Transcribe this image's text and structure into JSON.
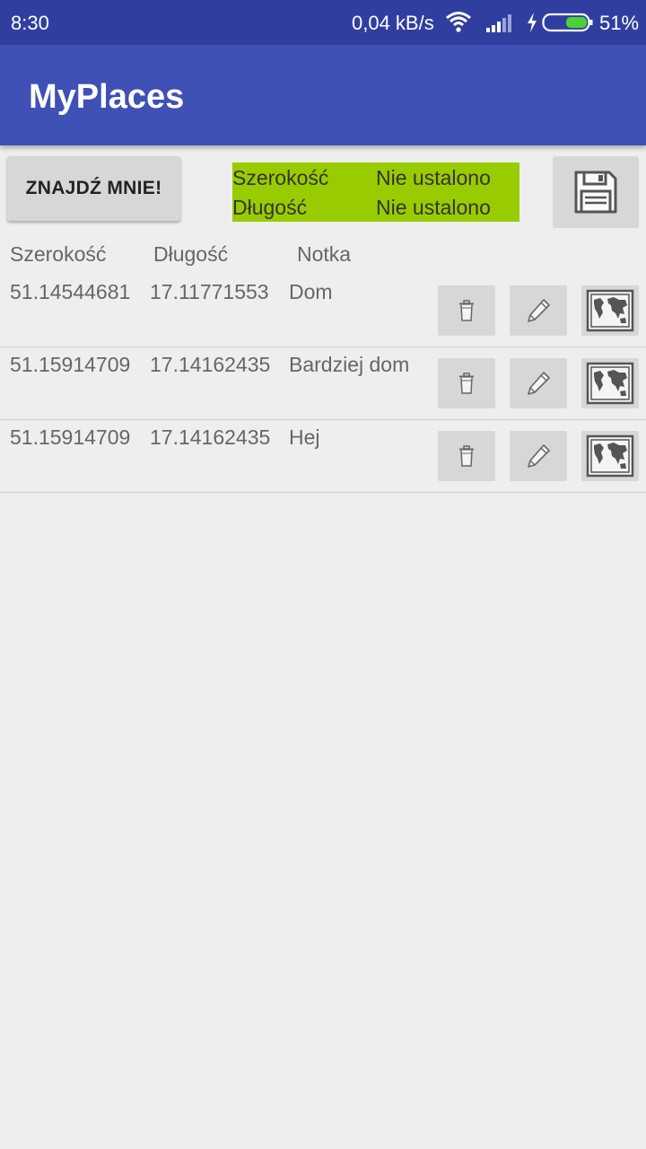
{
  "status_bar": {
    "time": "8:30",
    "network_speed": "0,04 kB/s",
    "battery_percent": "51%",
    "battery_level": 0.51,
    "icons": [
      "wifi-icon",
      "signal-icon",
      "charging-icon",
      "battery-icon"
    ]
  },
  "app_bar": {
    "title": "MyPlaces"
  },
  "controls": {
    "find_me_label": "ZNAJDŹ MNIE!",
    "current_location": {
      "lat_label": "Szerokość",
      "lat_value": "Nie ustalono",
      "lon_label": "Długość",
      "lon_value": "Nie ustalono"
    },
    "save_icon": "floppy-disk-icon"
  },
  "table": {
    "headers": {
      "lat": "Szerokość",
      "lon": "Długość",
      "note": "Notka"
    },
    "rows": [
      {
        "lat": "51.14544681",
        "lon": "17.11771553",
        "note": "Dom"
      },
      {
        "lat": "51.15914709",
        "lon": "17.14162435",
        "note": "Bardziej dom"
      },
      {
        "lat": "51.15914709",
        "lon": "17.14162435",
        "note": "Hej"
      }
    ],
    "row_actions": [
      "trash-icon",
      "pencil-icon",
      "map-icon"
    ]
  },
  "colors": {
    "status_bar": "#303f9f",
    "app_bar": "#3f51b5",
    "location_box": "#99cc00",
    "background": "#eeeeee",
    "button": "#d6d7d7"
  }
}
